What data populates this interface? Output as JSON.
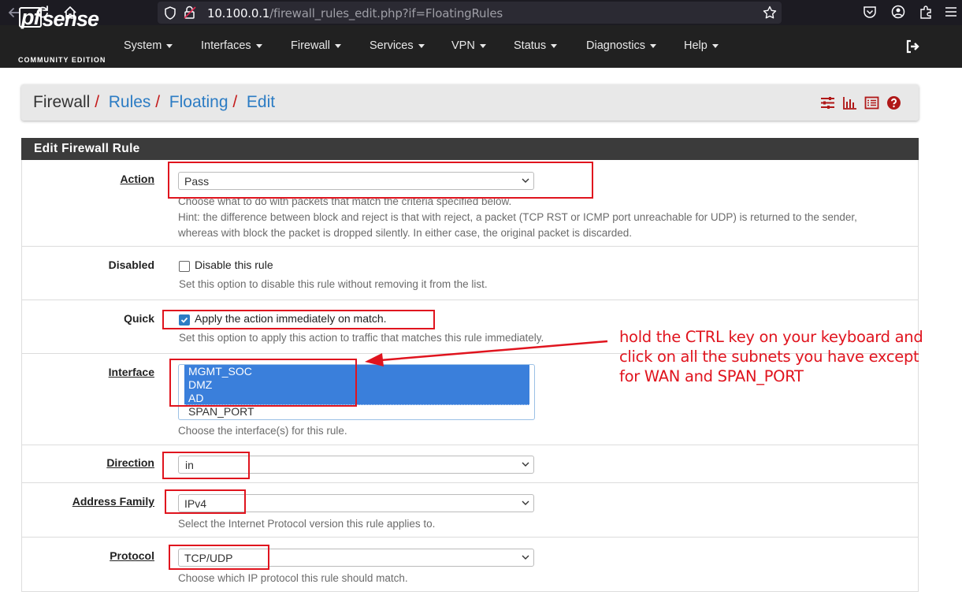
{
  "browser": {
    "url_host": "10.100.0.1",
    "url_path": "/firewall_rules_edit.php?if=FloatingRules"
  },
  "logo": {
    "pf": "pf",
    "sense": "sense",
    "edition": "COMMUNITY EDITION"
  },
  "menu": {
    "items": [
      "System",
      "Interfaces",
      "Firewall",
      "Services",
      "VPN",
      "Status",
      "Diagnostics",
      "Help"
    ]
  },
  "breadcrumb": {
    "root": "Firewall",
    "sep": "/",
    "links": [
      "Rules",
      "Floating",
      "Edit"
    ]
  },
  "panel": {
    "title": "Edit Firewall Rule"
  },
  "form": {
    "action": {
      "label": "Action",
      "value": "Pass",
      "help_1": "Choose what to do with packets that match the criteria specified below.",
      "help_2": "Hint: the difference between block and reject is that with reject, a packet (TCP RST or ICMP port unreachable for UDP) is returned to the sender,",
      "help_3": "whereas with block the packet is dropped silently. In either case, the original packet is discarded."
    },
    "disabled": {
      "label": "Disabled",
      "checkbox_label": "Disable this rule",
      "checked": false,
      "help": "Set this option to disable this rule without removing it from the list."
    },
    "quick": {
      "label": "Quick",
      "checkbox_label": "Apply the action immediately on match.",
      "checked": true,
      "help": "Set this option to apply this action to traffic that matches this rule immediately."
    },
    "interface": {
      "label": "Interface",
      "options": [
        {
          "name": "MGMT_SOC",
          "selected": true
        },
        {
          "name": "DMZ",
          "selected": true
        },
        {
          "name": "AD",
          "selected": true
        },
        {
          "name": "SPAN_PORT",
          "selected": false
        }
      ],
      "help": "Choose the interface(s) for this rule."
    },
    "direction": {
      "label": "Direction",
      "value": "in"
    },
    "address_family": {
      "label": "Address Family",
      "value": "IPv4",
      "help": "Select the Internet Protocol version this rule applies to."
    },
    "protocol": {
      "label": "Protocol",
      "value": "TCP/UDP",
      "help": "Choose which IP protocol this rule should match."
    }
  },
  "annotation": {
    "line_1": "hold the CTRL key on your keyboard and",
    "line_2": "click on all the subnets you have except",
    "line_3": "for WAN and SPAN_PORT",
    "color": "#e0141e"
  },
  "colors": {
    "link": "#2c7cc4",
    "navbar": "#212121",
    "panel_header": "#3b3b3b",
    "selected_option": "#3a7fdb"
  }
}
